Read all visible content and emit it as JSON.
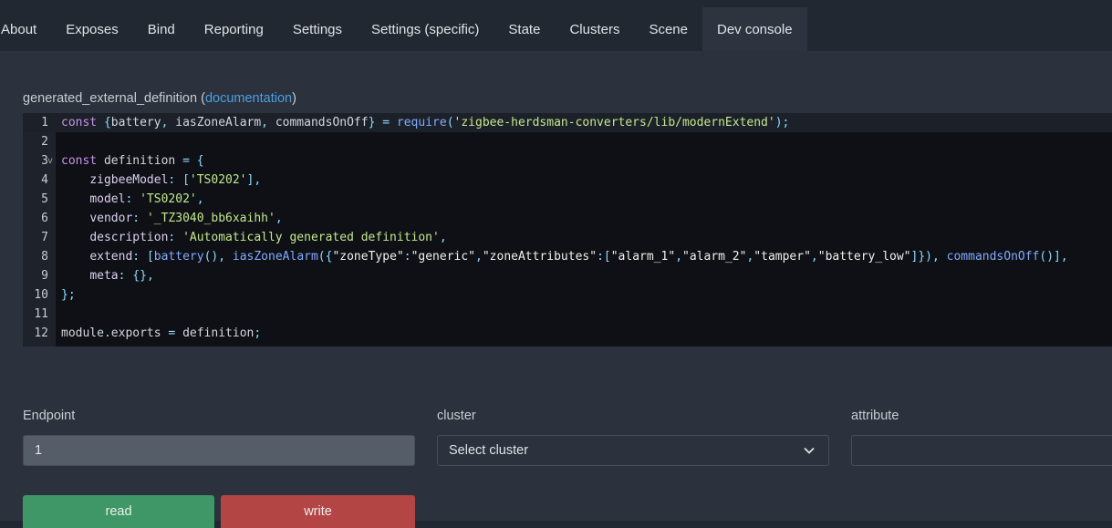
{
  "tabs": [
    {
      "label": "About"
    },
    {
      "label": "Exposes"
    },
    {
      "label": "Bind"
    },
    {
      "label": "Reporting"
    },
    {
      "label": "Settings"
    },
    {
      "label": "Settings (specific)"
    },
    {
      "label": "State"
    },
    {
      "label": "Clusters"
    },
    {
      "label": "Scene"
    },
    {
      "label": "Dev console",
      "active": true
    }
  ],
  "definition": {
    "label": "generated_external_definition",
    "open_paren": "(",
    "link": "documentation",
    "close_paren": ")"
  },
  "code_lines": [
    "const {battery, iasZoneAlarm, commandsOnOff} = require('zigbee-herdsman-converters/lib/modernExtend');",
    "",
    "const definition = {",
    "    zigbeeModel: ['TS0202'],",
    "    model: 'TS0202',",
    "    vendor: '_TZ3040_bb6xaihh',",
    "    description: 'Automatically generated definition',",
    "    extend: [battery(), iasZoneAlarm({\"zoneType\":\"generic\",\"zoneAttributes\":[\"alarm_1\",\"alarm_2\",\"tamper\",\"battery_low\"]}), commandsOnOff()],",
    "    meta: {},",
    "};",
    "",
    "module.exports = definition;"
  ],
  "line_numbers": [
    "1",
    "2",
    "3",
    "4",
    "5",
    "6",
    "7",
    "8",
    "9",
    "10",
    "11",
    "12"
  ],
  "fold_marker": "v",
  "form": {
    "endpoint_label": "Endpoint",
    "endpoint_value": "1",
    "cluster_label": "cluster",
    "cluster_placeholder": "Select cluster",
    "attribute_label": "attribute",
    "attribute_value": ""
  },
  "buttons": {
    "read": "read",
    "write": "write"
  },
  "icons": {
    "dropdown": "chevron-down-icon",
    "fold": "fold-arrow-icon"
  },
  "colors": {
    "read_button": "#3f9666",
    "write_button": "#b34545",
    "link": "#4b9fe5"
  }
}
